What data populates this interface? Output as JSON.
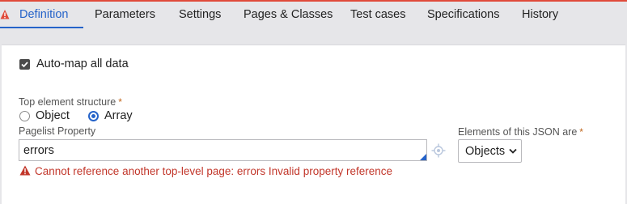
{
  "tabs": [
    {
      "label": "Definition",
      "active": true
    },
    {
      "label": "Parameters"
    },
    {
      "label": "Settings"
    },
    {
      "label": "Pages & Classes"
    },
    {
      "label": "Test cases"
    },
    {
      "label": "Specifications"
    },
    {
      "label": "History"
    }
  ],
  "automap": {
    "label": "Auto-map all data",
    "checked": true
  },
  "top_element": {
    "label": "Top element structure",
    "required_marker": "*",
    "options": [
      {
        "label": "Object",
        "selected": false
      },
      {
        "label": "Array",
        "selected": true
      }
    ]
  },
  "pagelist": {
    "label": "Pagelist Property",
    "value": "errors",
    "error": "Cannot reference another top-level page: errors Invalid property reference"
  },
  "elements": {
    "label": "Elements of this JSON are",
    "required_marker": "*",
    "selected": "Objects"
  },
  "colors": {
    "accent": "#2563c9",
    "error": "#c2372b",
    "required": "#c0641a",
    "tab_bar": "#e6e6e9"
  }
}
